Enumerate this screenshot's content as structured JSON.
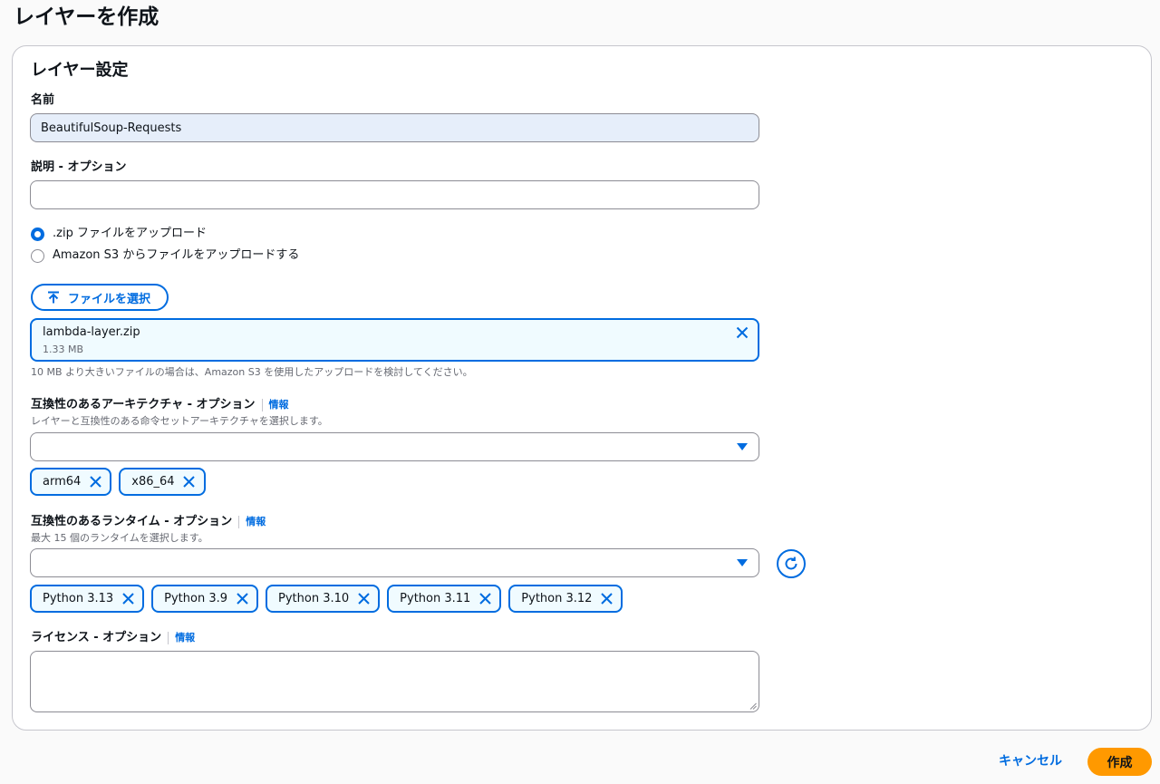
{
  "page": {
    "title": "レイヤーを作成"
  },
  "settings": {
    "section_title": "レイヤー設定",
    "name": {
      "label": "名前",
      "value": "BeautifulSoup-Requests"
    },
    "description": {
      "label": "説明 - オプション",
      "value": ""
    },
    "upload_options": [
      {
        "label": ".zip ファイルをアップロード",
        "checked": true
      },
      {
        "label": "Amazon S3 からファイルをアップロードする",
        "checked": false
      }
    ],
    "file_button_label": "ファイルを選択",
    "file": {
      "name": "lambda-layer.zip",
      "size": "1.33 MB"
    },
    "file_hint": "10 MB より大きいファイルの場合は、Amazon S3 を使用したアップロードを検討してください。",
    "architecture": {
      "label": "互換性のあるアーキテクチャ - オプション",
      "info": "情報",
      "description": "レイヤーと互換性のある命令セットアーキテクチャを選択します。",
      "tokens": [
        "arm64",
        "x86_64"
      ]
    },
    "runtime": {
      "label": "互換性のあるランタイム - オプション",
      "info": "情報",
      "description": "最大 15 個のランタイムを選択します。",
      "tokens": [
        "Python 3.13",
        "Python 3.9",
        "Python 3.10",
        "Python 3.11",
        "Python 3.12"
      ]
    },
    "license": {
      "label": "ライセンス - オプション",
      "info": "情報",
      "value": ""
    }
  },
  "footer": {
    "cancel_label": "キャンセル",
    "create_label": "作成"
  },
  "colors": {
    "accent": "#006ce0",
    "primary_button": "#ff9900",
    "token_bg": "#f0fbff",
    "filled_input_bg": "#e6eefa"
  },
  "icons": {
    "upload": "upload-arrow-icon",
    "close": "close-icon",
    "caret": "caret-down-icon",
    "refresh": "refresh-icon"
  }
}
